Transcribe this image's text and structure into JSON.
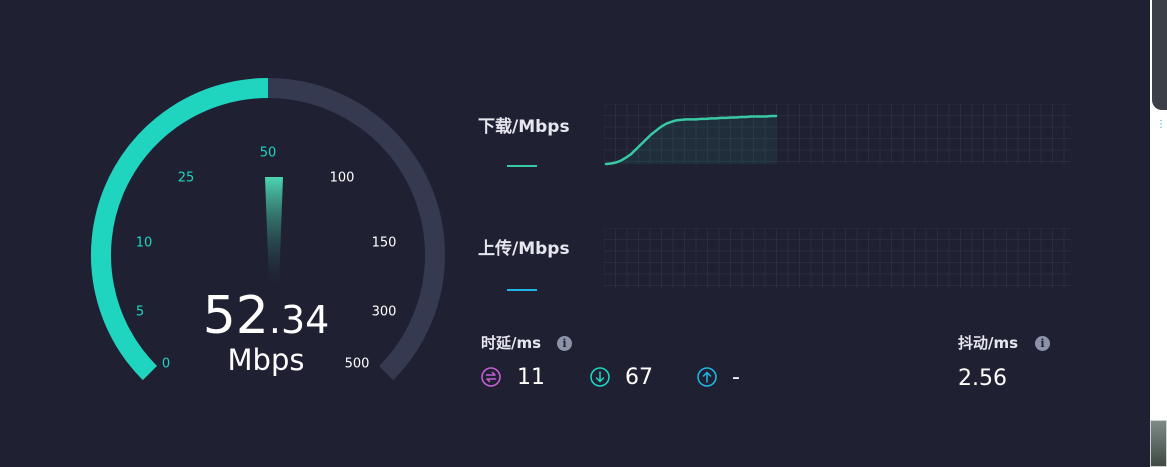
{
  "gauge": {
    "speed_int": "52",
    "speed_dec": ".34",
    "unit": "Mbps",
    "ticks": [
      "0",
      "5",
      "10",
      "25",
      "50",
      "100",
      "150",
      "300",
      "500"
    ],
    "active_color": "#1fd5c0",
    "track_color": "#363a50"
  },
  "download": {
    "label": "下载/Mbps",
    "color": "#38c9a4",
    "series": [
      0.0,
      0.01,
      0.03,
      0.07,
      0.13,
      0.2,
      0.3,
      0.4,
      0.5,
      0.6,
      0.68,
      0.76,
      0.82,
      0.86,
      0.89,
      0.9,
      0.91,
      0.91,
      0.91,
      0.92,
      0.92,
      0.93,
      0.93,
      0.94,
      0.94,
      0.95,
      0.95,
      0.96,
      0.96,
      0.97,
      0.97,
      0.97,
      0.97,
      0.98,
      0.98
    ]
  },
  "upload": {
    "label": "上传/Mbps",
    "color": "#1fb6e3"
  },
  "latency": {
    "label": "时延/ms",
    "idle": "11",
    "down": "67",
    "up": "-",
    "idle_icon": "swap-horizontal-icon",
    "down_icon": "arrow-down-circle-icon",
    "up_icon": "arrow-up-circle-icon",
    "idle_color": "#c65fd6",
    "down_color": "#1fd5c0",
    "up_color": "#1fb6e3"
  },
  "jitter": {
    "label": "抖动/ms",
    "value": "2.56"
  },
  "info_icon_glyph": "i"
}
